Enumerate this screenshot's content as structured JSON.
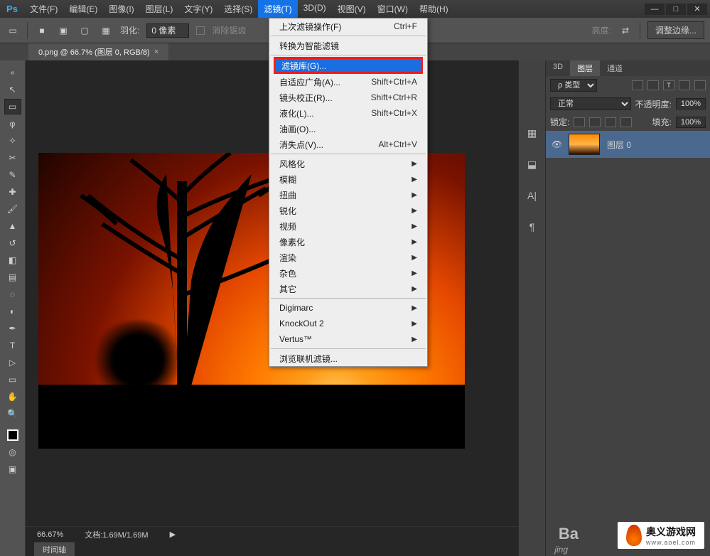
{
  "app": {
    "logo": "Ps"
  },
  "menu": {
    "file": "文件(F)",
    "edit": "编辑(E)",
    "image": "图像(I)",
    "layer": "图层(L)",
    "type": "文字(Y)",
    "select": "选择(S)",
    "filter": "滤镜(T)",
    "threeD": "3D(D)",
    "view": "视图(V)",
    "window": "窗口(W)",
    "help": "帮助(H)"
  },
  "options": {
    "feather_label": "羽化:",
    "feather_value": "0 像素",
    "antialias": "消除锯齿",
    "height": "高度:",
    "refine": "调整边缘..."
  },
  "doc_tab": {
    "title": "0.png @ 66.7% (图层 0, RGB/8)",
    "close": "×"
  },
  "tool_collapse": "«",
  "dropdown": {
    "last": "上次滤镜操作(F)",
    "last_sc": "Ctrl+F",
    "convert": "转换为智能滤镜",
    "gallery": "滤镜库(G)...",
    "adaptive": "自适应广角(A)...",
    "adaptive_sc": "Shift+Ctrl+A",
    "lens": "镜头校正(R)...",
    "lens_sc": "Shift+Ctrl+R",
    "liquify": "液化(L)...",
    "liquify_sc": "Shift+Ctrl+X",
    "oil": "油画(O)...",
    "vanish": "消失点(V)...",
    "vanish_sc": "Alt+Ctrl+V",
    "stylize": "风格化",
    "blur": "模糊",
    "distort": "扭曲",
    "sharpen": "锐化",
    "video": "视频",
    "pixelate": "像素化",
    "render": "渲染",
    "noise": "杂色",
    "other": "其它",
    "digimarc": "Digimarc",
    "knockout": "KnockOut 2",
    "vertus": "Vertus™",
    "browse": "浏览联机滤镜..."
  },
  "panels": {
    "tab_3d": "3D",
    "tab_layers": "图层",
    "tab_channels": "通道",
    "kind": "ρ 类型",
    "mode": "正常",
    "opacity_label": "不透明度:",
    "opacity": "100%",
    "lock_label": "锁定:",
    "fill_label": "填充:",
    "fill": "100%",
    "layer0": "图层 0"
  },
  "status": {
    "zoom": "66.67%",
    "doc": "文档:1.69M/1.69M",
    "timeline": "时间轴"
  },
  "watermark": {
    "bai": "Ba",
    "jing": "jing",
    "site": "奥义游戏网",
    "url": "www.aoel.com"
  }
}
